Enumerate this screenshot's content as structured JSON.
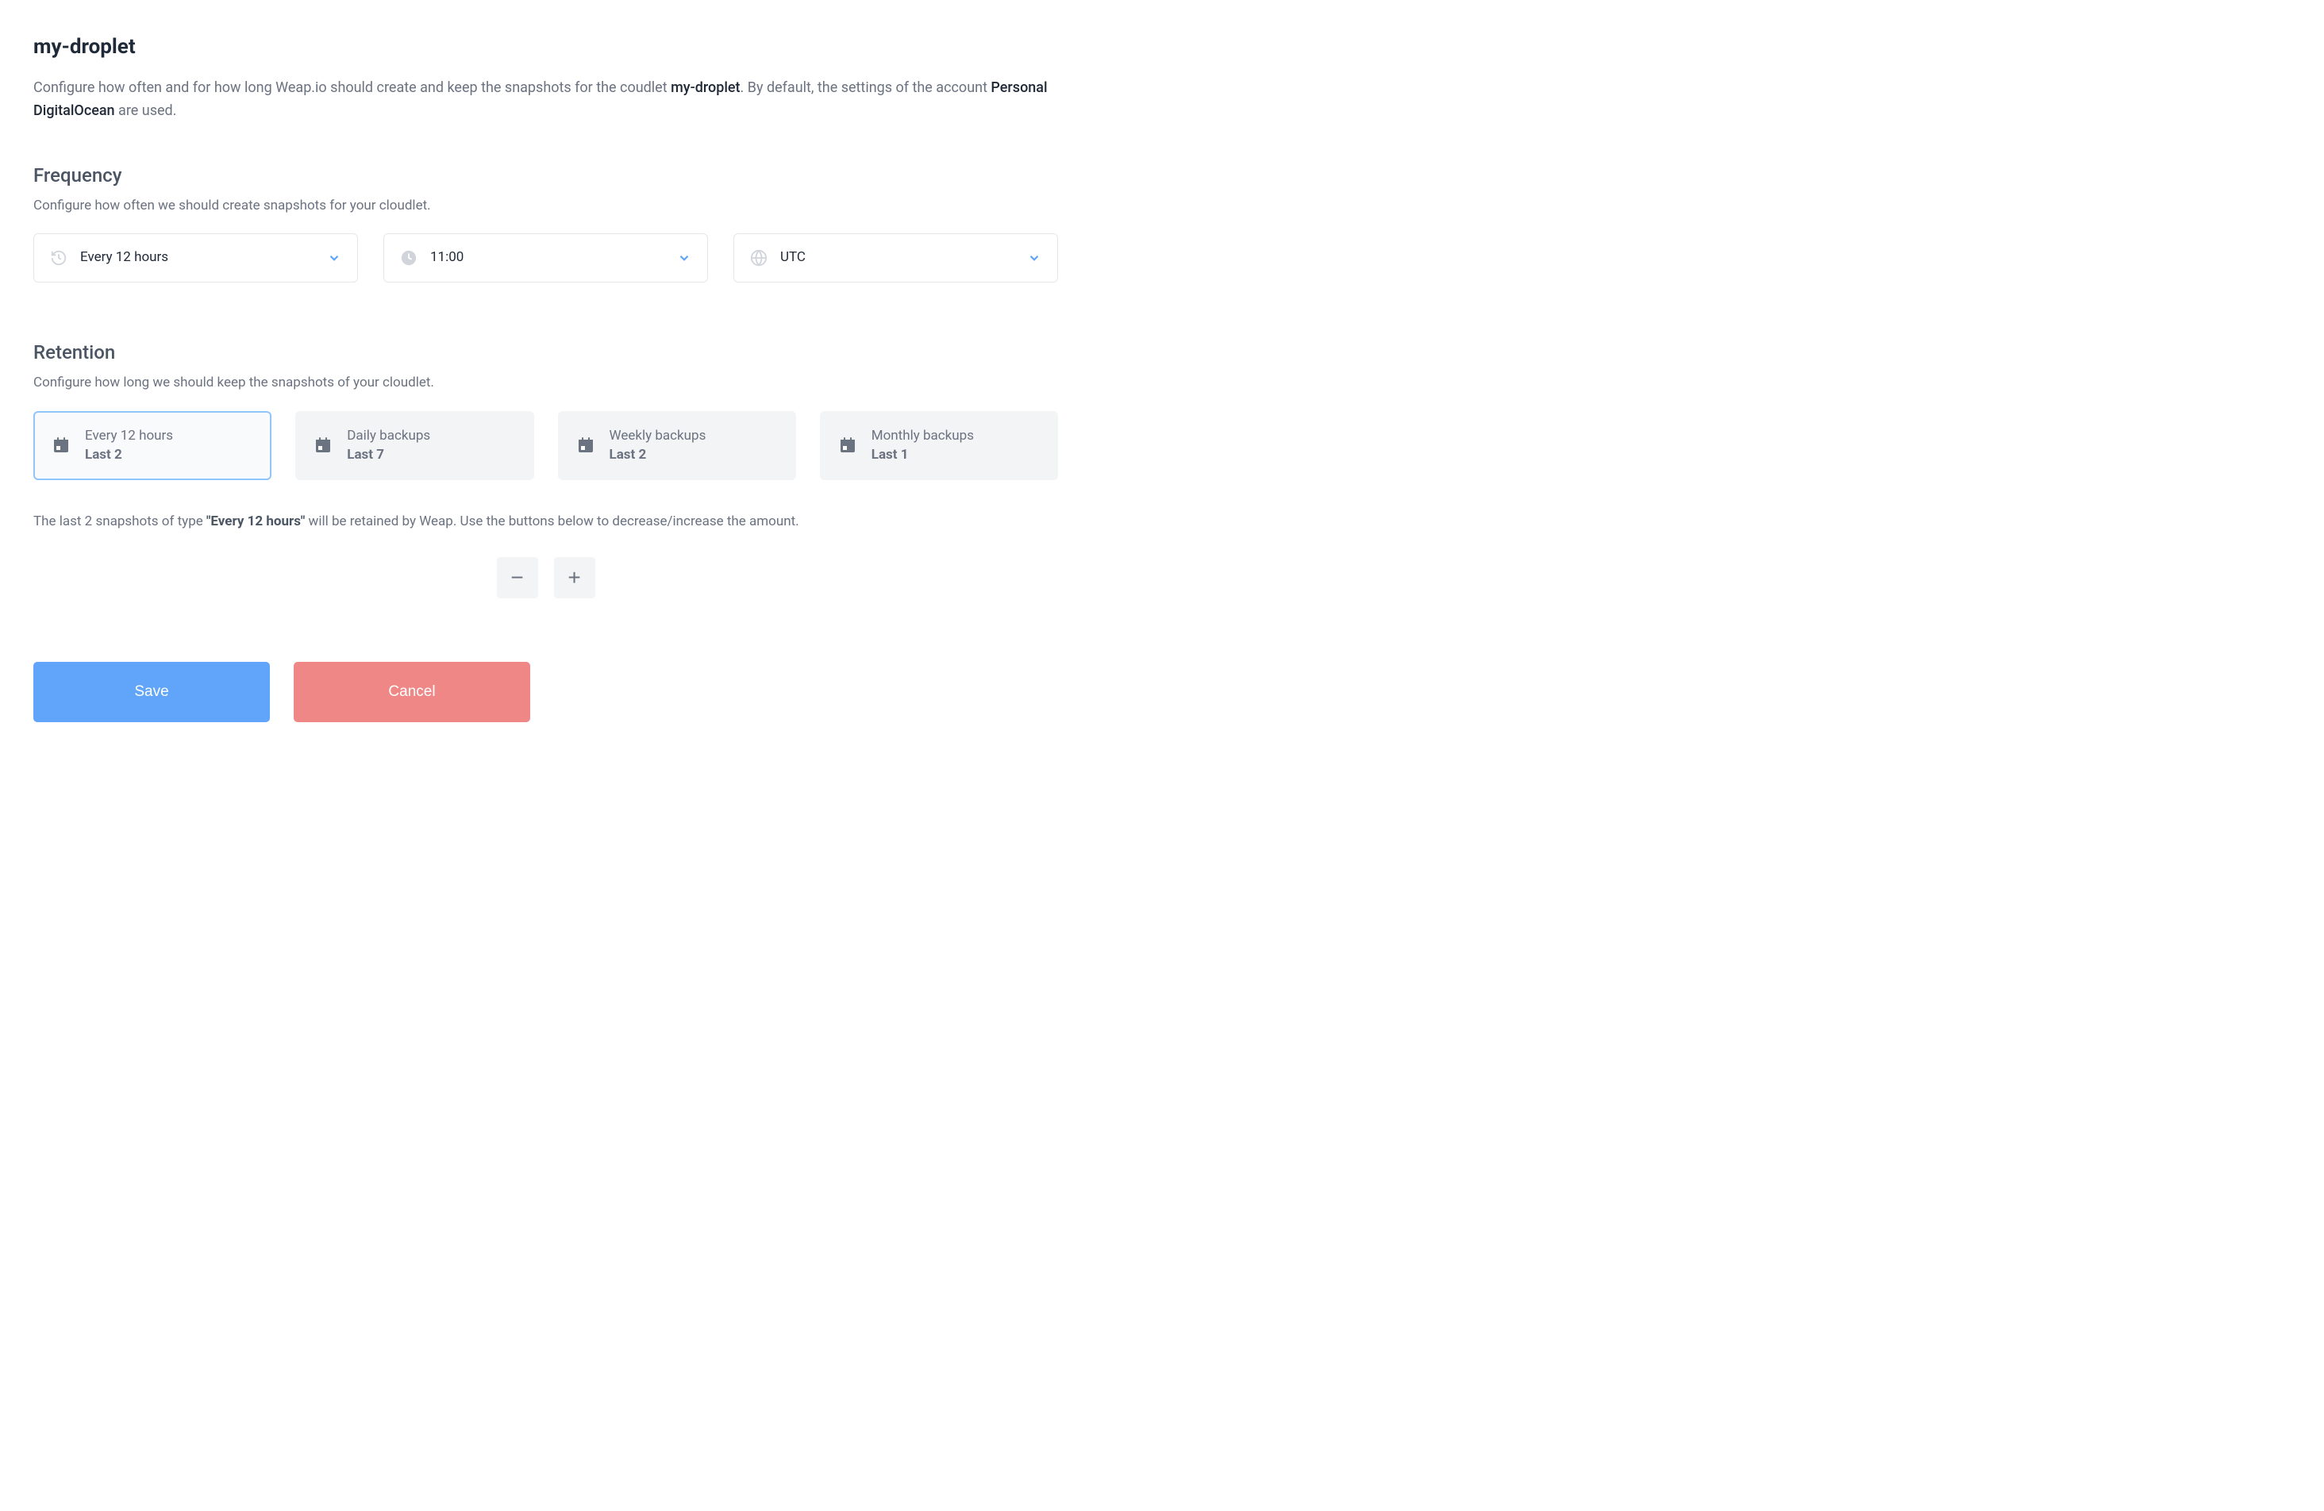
{
  "title": "my-droplet",
  "desc": {
    "pre": "Configure how often and for how long Weap.io should create and keep the snapshots for the coudlet ",
    "name": "my-droplet",
    "mid": ". By default, the settings of the account ",
    "account": "Personal DigitalOcean",
    "post": " are used."
  },
  "frequency": {
    "title": "Frequency",
    "desc": "Configure how often we should create snapshots for your cloudlet.",
    "interval": "Every 12 hours",
    "time": "11:00",
    "tz": "UTC"
  },
  "retention": {
    "title": "Retention",
    "desc": "Configure how long we should keep the snapshots of your cloudlet.",
    "cards": [
      {
        "label": "Every 12 hours",
        "value": "Last 2",
        "active": true
      },
      {
        "label": "Daily backups",
        "value": "Last 7",
        "active": false
      },
      {
        "label": "Weekly backups",
        "value": "Last 2",
        "active": false
      },
      {
        "label": "Monthly backups",
        "value": "Last 1",
        "active": false
      }
    ],
    "detail": {
      "pre": "The last 2 snapshots of type ",
      "strong": "\"Every 12 hours\"",
      "post": " will be retained by Weap. Use the buttons below to decrease/increase the amount."
    }
  },
  "stepper": {
    "minus": "−",
    "plus": "+"
  },
  "actions": {
    "save": "Save",
    "cancel": "Cancel"
  }
}
